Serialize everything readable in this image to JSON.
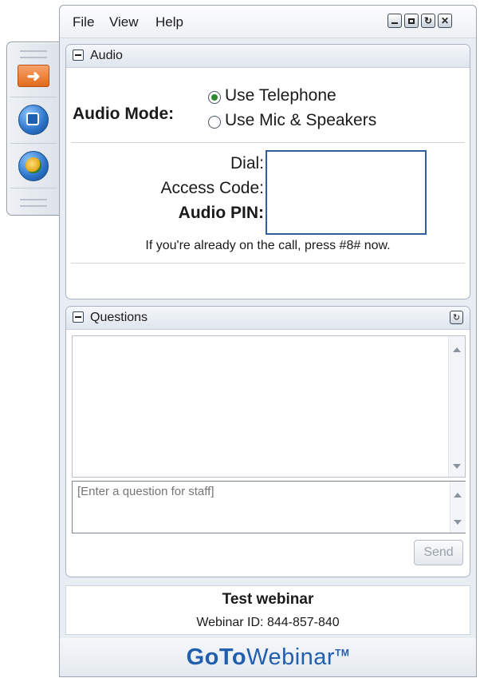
{
  "menu": {
    "file": "File",
    "view": "View",
    "help": "Help"
  },
  "audio": {
    "header": "Audio",
    "mode_label": "Audio Mode:",
    "options": [
      "Use Telephone",
      "Use Mic & Speakers"
    ],
    "selected_option": "Use Telephone",
    "dial_label": "Dial:",
    "access_label": "Access Code:",
    "pin_label": "Audio PIN:",
    "notice": "If you're already on the call, press #8# now."
  },
  "questions": {
    "header": "Questions",
    "input_placeholder": "[Enter a question for staff]",
    "send_label": "Send"
  },
  "webinar": {
    "title": "Test webinar",
    "id_line": "Webinar ID: 844-857-840"
  },
  "brand": {
    "logo_bold": "GoTo",
    "logo_light": "Webinar",
    "logo_tm": "TM"
  },
  "icons": {
    "grabtab": [
      "arrow-right-icon",
      "stop-icon",
      "raise-hand-icon"
    ],
    "window": [
      "minimize-icon",
      "restore-icon",
      "popout-icon",
      "close-icon"
    ]
  },
  "colors": {
    "accent_blue": "#1f5fae",
    "grab_orange": "#e26a1e",
    "selected_radio": "#2c8b2c"
  }
}
